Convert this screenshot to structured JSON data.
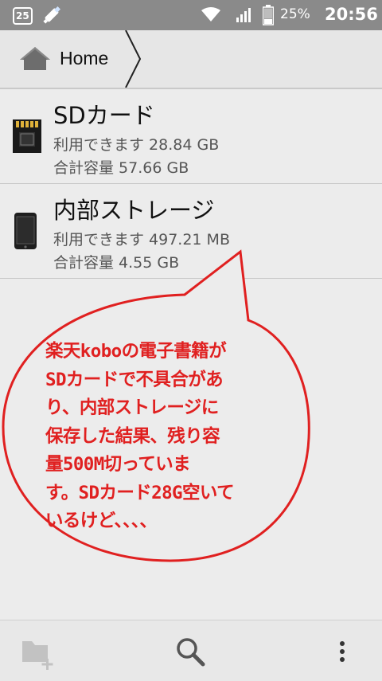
{
  "status_bar": {
    "notification_badge": "25",
    "battery_percent": "25%",
    "time": "20:56",
    "icons": [
      "notification-count-icon",
      "usb-debug-icon",
      "wifi-icon",
      "signal-icon",
      "battery-icon"
    ]
  },
  "breadcrumb": {
    "home_label": "Home"
  },
  "storage": [
    {
      "name": "SDカード",
      "available": "利用できます 28.84 GB",
      "total": "合計容量 57.66 GB",
      "icon": "sd-card-icon"
    },
    {
      "name": "内部ストレージ",
      "available": "利用できます 497.21 MB",
      "total": "合計容量 4.55 GB",
      "icon": "phone-device-icon"
    }
  ],
  "annotation": {
    "text": "楽天koboの電子書籍が\nSDカードで不具合があ\nり、内部ストレージに\n保存した結果、残り容\n量500M切っていま\nす。SDカード28G空いて\nいるけど、、、、",
    "color": "#e02020"
  },
  "toolbar": {
    "icons": [
      "new-folder-icon",
      "search-icon",
      "more-vert-icon"
    ]
  }
}
